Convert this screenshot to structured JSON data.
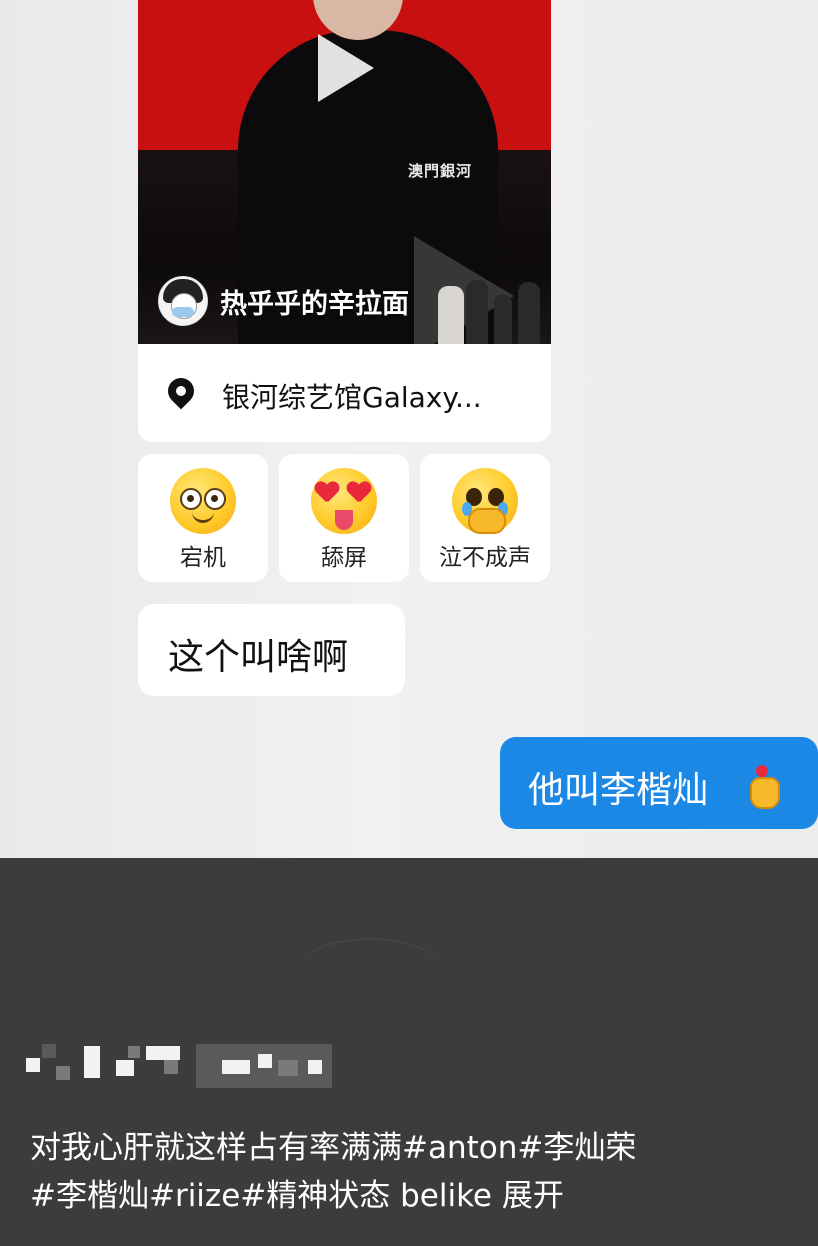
{
  "video": {
    "watermark": "澳門銀河",
    "author_name": "热乎乎的辛拉面"
  },
  "location": {
    "icon": "location-pin-icon",
    "text": "银河综艺馆Galaxy..."
  },
  "reactions": [
    {
      "label": "宕机",
      "icon": "dazed-face-icon"
    },
    {
      "label": "舔屏",
      "icon": "heart-eyes-tongue-icon"
    },
    {
      "label": "泣不成声",
      "icon": "crying-face-icon"
    }
  ],
  "messages": {
    "received": "这个叫啥啊",
    "sent": "他叫李楷灿",
    "sent_icon": "finger-heart-icon"
  },
  "post": {
    "caption_line1": "对我心肝就这样占有率满满#anton#李灿荣",
    "caption_line2": "#李楷灿#riize#精神状态 belike  展开"
  },
  "colors": {
    "sent_bubble": "#1b88e6",
    "video_red": "#c81010",
    "bottom_panel": "#3c3c3c"
  }
}
